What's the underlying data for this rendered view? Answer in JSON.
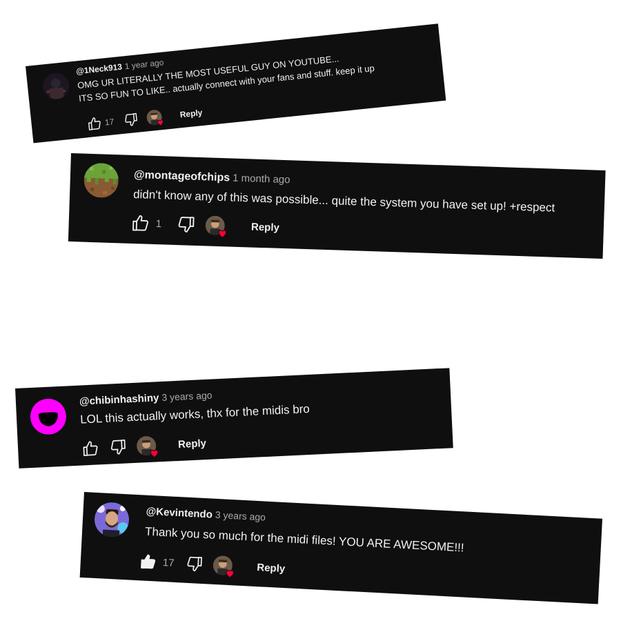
{
  "comments": [
    {
      "handle": "@1Neck913",
      "time": "1 year ago",
      "lines": [
        "OMG UR LITERALLY THE MOST USEFUL GUY ON YOUTUBE...",
        "ITS SO FUN TO LIKE.. actually connect with your fans and stuff. keep it up"
      ],
      "likes": "17",
      "like_state": "outline",
      "reply_label": "Reply",
      "avatar_icon": "dark-figure-avatar-icon"
    },
    {
      "handle": "@montageofchips",
      "time": "1 month ago",
      "lines": [
        "didn't know any of this was possible... quite the system you have set up! +respect"
      ],
      "likes": "1",
      "like_state": "outline",
      "reply_label": "Reply",
      "avatar_icon": "grass-block-avatar-icon"
    },
    {
      "handle": "@chibinhashiny",
      "time": "3 years ago",
      "lines": [
        "LOL this actually works, thx for the midis bro"
      ],
      "likes": "",
      "like_state": "outline",
      "reply_label": "Reply",
      "avatar_icon": "magenta-face-avatar-icon"
    },
    {
      "handle": "@Kevintendo",
      "time": "3 years ago",
      "lines": [
        "Thank you so much for the midi files! YOU ARE AWESOME!!!"
      ],
      "likes": "17",
      "like_state": "filled",
      "reply_label": "Reply",
      "avatar_icon": "person-photo-avatar-icon"
    }
  ],
  "colors": {
    "card_bg": "#0f0f0f",
    "text": "#f1f1f1",
    "muted": "#aaaaaa",
    "heart": "#ff0033",
    "magenta": "#ff00ff"
  }
}
